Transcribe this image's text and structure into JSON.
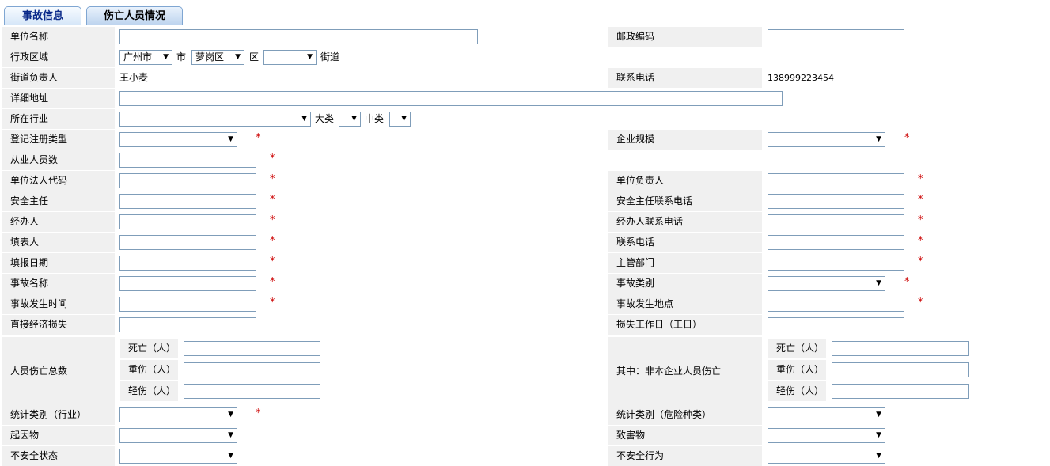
{
  "tabs": {
    "accident_info": "事故信息",
    "casualty_status": "伤亡人员情况"
  },
  "form": {
    "unit_name_label": "单位名称",
    "postcode_label": "邮政编码",
    "region_label": "行政区域",
    "region_city": "广州市",
    "region_city_suffix": "市",
    "region_district": "萝岗区",
    "region_district_suffix": "区",
    "region_street_suffix": "街道",
    "street_head_label": "街道负责人",
    "street_head_value": "王小麦",
    "contact_phone_label": "联系电话",
    "contact_phone_value": "138999223454",
    "address_label": "详细地址",
    "industry_label": "所在行业",
    "industry_major": "大类",
    "industry_middle": "中类",
    "reg_type_label": "登记注册类型",
    "enterprise_scale_label": "企业规模",
    "employees_label": "从业人员数",
    "legal_code_label": "单位法人代码",
    "unit_head_label": "单位负责人",
    "safety_director_label": "安全主任",
    "safety_director_phone_label": "安全主任联系电话",
    "handler_label": "经办人",
    "handler_phone_label": "经办人联系电话",
    "filler_label": "填表人",
    "filler_phone_label": "联系电话",
    "fill_date_label": "填报日期",
    "authority_label": "主管部门",
    "accident_name_label": "事故名称",
    "accident_category_label": "事故类别",
    "accident_time_label": "事故发生时间",
    "accident_place_label": "事故发生地点",
    "direct_loss_label": "直接经济损失",
    "lost_workdays_label": "损失工作日（工日）",
    "casualty_total_label": "人员伤亡总数",
    "non_enterprise_label": "其中：非本企业人员伤亡",
    "death_label": "死亡（人）",
    "serious_label": "重伤（人）",
    "minor_label": "轻伤（人）",
    "stat_industry_label": "统计类别（行业）",
    "stat_hazard_label": "统计类别（危险种类）",
    "cause_label": "起因物",
    "harm_label": "致害物",
    "unsafe_state_label": "不安全状态",
    "unsafe_act_label": "不安全行为",
    "required_mark": "*",
    "dropdown_arrow": "▼"
  }
}
